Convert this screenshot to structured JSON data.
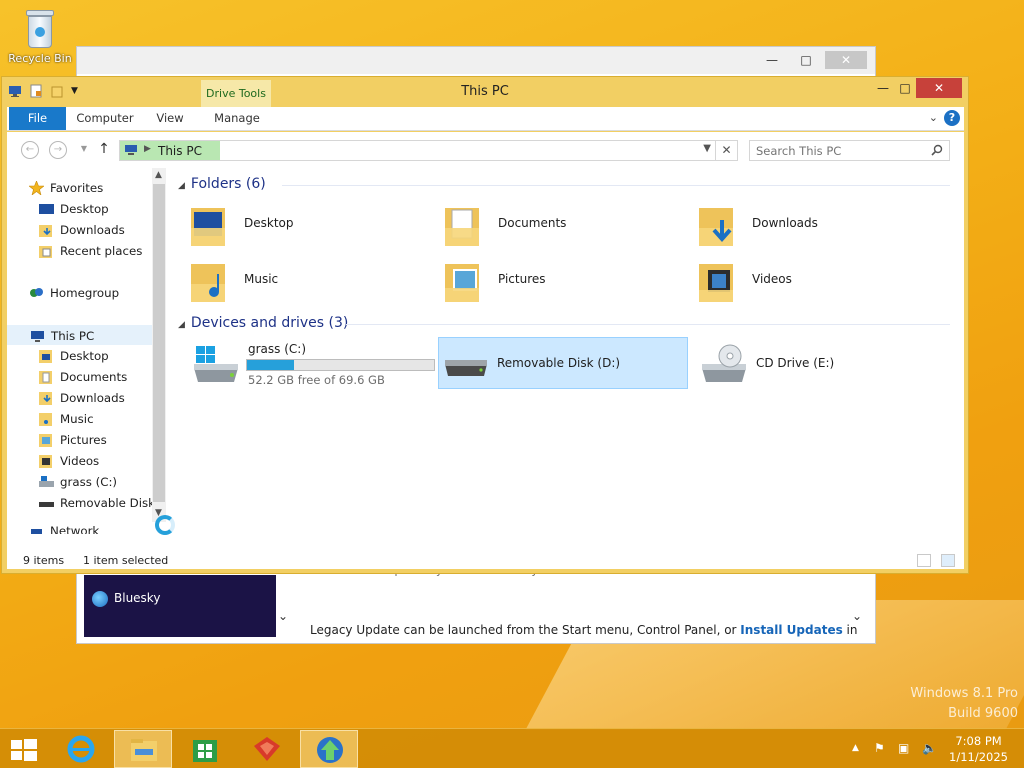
{
  "desktop": {
    "recycle_bin_label": "Recycle Bin",
    "watermark_line1": "Windows 8.1 Pro",
    "watermark_line2": "Build 9600"
  },
  "background_window": {
    "sidebar_item": "Bluesky",
    "partial_text": "compatibility - Release history",
    "body_text": "Legacy Update can be launched from the Start menu, Control Panel, or ",
    "link_text": "Install Updates",
    "body_text_after": " in"
  },
  "explorer": {
    "title": "This PC",
    "context_group_label": "Drive Tools",
    "colors": {
      "file_tab": "#1979ca",
      "selection": "#cce8ff",
      "progress": "#26a0da",
      "group_heading": "#1e3287",
      "close_button": "#c7413a"
    },
    "tabs": [
      {
        "label": "File"
      },
      {
        "label": "Computer"
      },
      {
        "label": "View"
      },
      {
        "label": "Manage"
      }
    ],
    "address": {
      "current": "This PC"
    },
    "search": {
      "placeholder": "Search This PC"
    },
    "nav_pane": {
      "favorites": {
        "label": "Favorites",
        "items": [
          "Desktop",
          "Downloads",
          "Recent places"
        ]
      },
      "homegroup": "Homegroup",
      "this_pc": {
        "label": "This PC",
        "items": [
          "Desktop",
          "Documents",
          "Downloads",
          "Music",
          "Pictures",
          "Videos",
          "grass (C:)",
          "Removable Disk (D:)"
        ]
      },
      "network": "Network"
    },
    "folders": {
      "heading": "Folders (6)",
      "items": [
        {
          "name": "Desktop",
          "icon": "desktop-folder-icon"
        },
        {
          "name": "Documents",
          "icon": "documents-folder-icon"
        },
        {
          "name": "Downloads",
          "icon": "downloads-folder-icon"
        },
        {
          "name": "Music",
          "icon": "music-folder-icon"
        },
        {
          "name": "Pictures",
          "icon": "pictures-folder-icon"
        },
        {
          "name": "Videos",
          "icon": "videos-folder-icon"
        }
      ]
    },
    "drives": {
      "heading": "Devices and drives (3)",
      "items": [
        {
          "name": "grass (C:)",
          "free_text": "52.2 GB free of 69.6 GB",
          "used_fraction": 0.25,
          "selected": false
        },
        {
          "name": "Removable Disk (D:)",
          "selected": true
        },
        {
          "name": "CD Drive (E:)",
          "selected": false
        }
      ]
    },
    "status": {
      "item_count": "9 items",
      "selection": "1 item selected"
    }
  },
  "taskbar": {
    "clock_time": "7:08 PM",
    "clock_date": "1/11/2025"
  }
}
